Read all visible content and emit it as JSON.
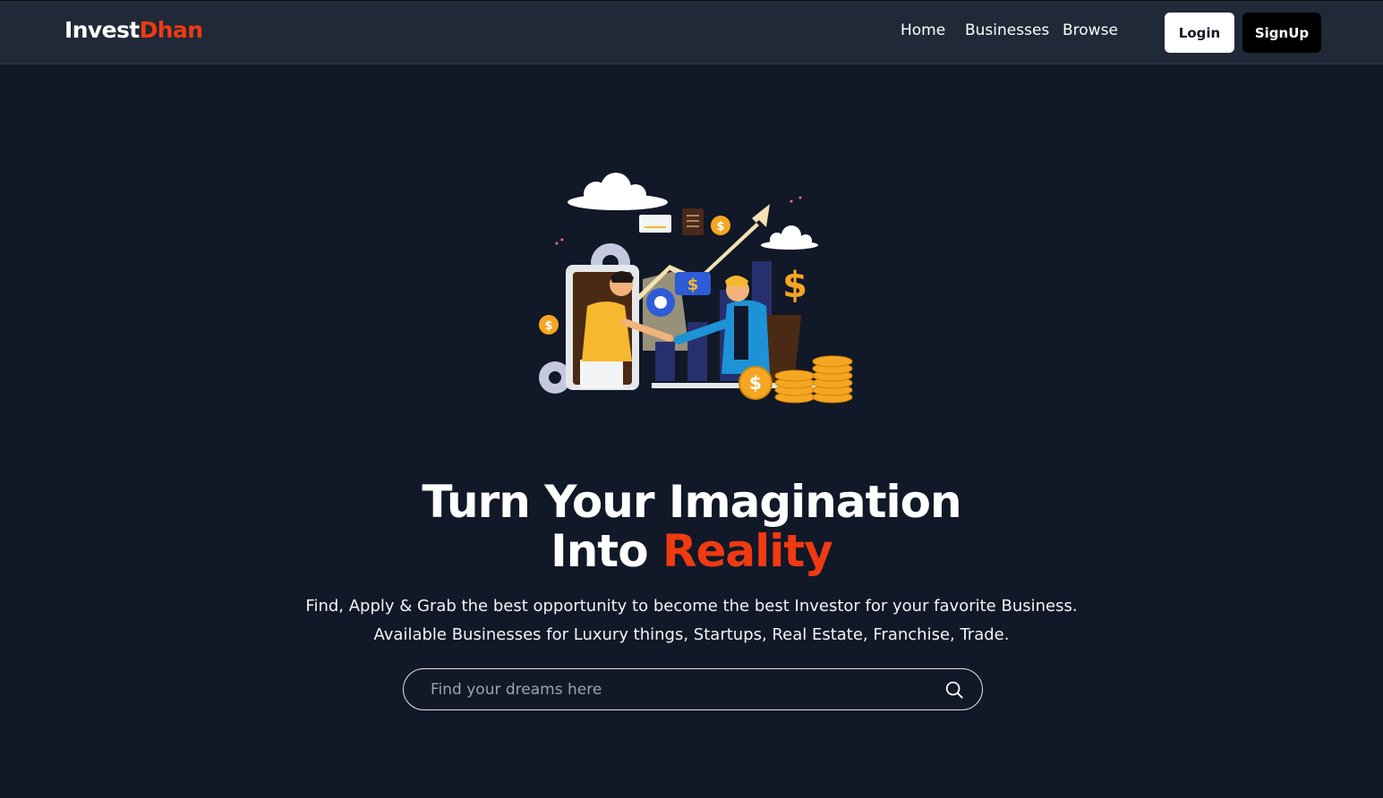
{
  "brand": {
    "part1": "Invest",
    "part2": "Dhan"
  },
  "nav": {
    "links": [
      {
        "label": "Home"
      },
      {
        "label": "Businesses"
      },
      {
        "label": "Browse"
      }
    ],
    "login_label": "Login",
    "signup_label": "SignUp"
  },
  "hero": {
    "illustration_icon": "investment-handshake-illustration",
    "headline_line1": "Turn Your Imagination",
    "headline_line2_prefix": "Into",
    "headline_line2_accent": "Reality",
    "subtext_line1": "Find, Apply & Grab the best opportunity to become the best Investor for your favorite Business.",
    "subtext_line2": "Available Businesses for Luxury things, Startups, Real Estate, Franchise, Trade."
  },
  "search": {
    "placeholder": "Find your dreams here",
    "value": "",
    "icon": "search-icon"
  },
  "colors": {
    "background": "#111827",
    "navbar": "#1f2937",
    "accent": "#ef3a12"
  }
}
